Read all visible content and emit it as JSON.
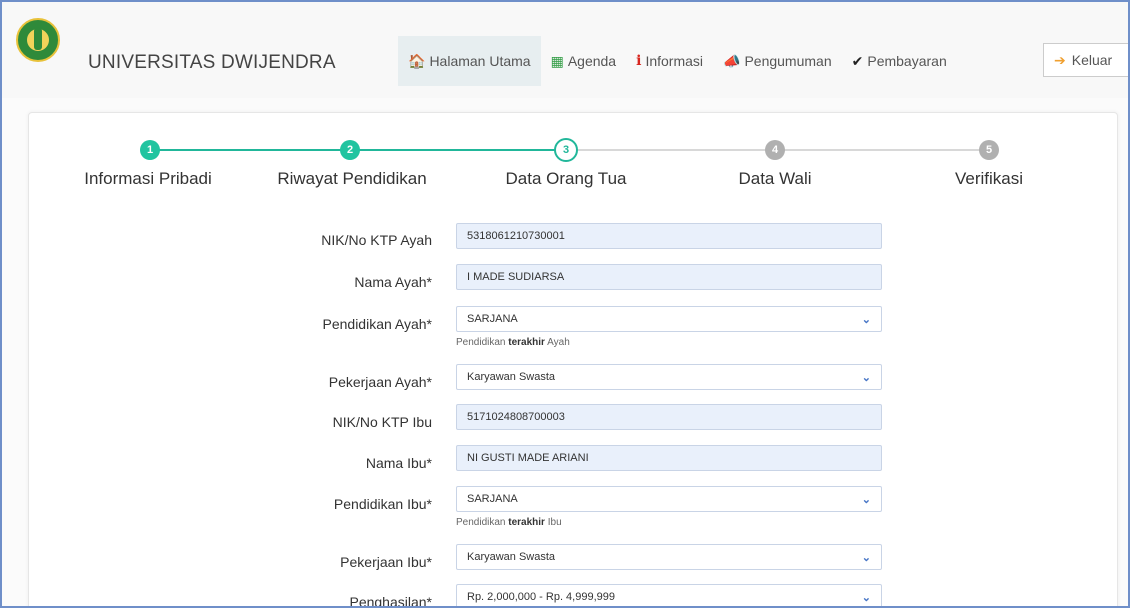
{
  "brand": {
    "name": "UNIVERSITAS DWIJENDRA"
  },
  "nav": {
    "items": [
      {
        "label": "Halaman Utama",
        "icon": "home-icon",
        "glyph": "🏠"
      },
      {
        "label": "Agenda",
        "icon": "calendar-icon",
        "glyph": "▦"
      },
      {
        "label": "Informasi",
        "icon": "info-icon",
        "glyph": "i"
      },
      {
        "label": "Pengumuman",
        "icon": "megaphone-icon",
        "glyph": "📣"
      },
      {
        "label": "Pembayaran",
        "icon": "check-icon",
        "glyph": "✔"
      }
    ],
    "logout_label": "Keluar"
  },
  "stepper": {
    "steps": [
      {
        "number": "1",
        "label": "Informasi Pribadi",
        "state": "done"
      },
      {
        "number": "2",
        "label": "Riwayat Pendidikan",
        "state": "done"
      },
      {
        "number": "3",
        "label": "Data Orang Tua",
        "state": "current"
      },
      {
        "number": "4",
        "label": "Data Wali",
        "state": "todo"
      },
      {
        "number": "5",
        "label": "Verifikasi",
        "state": "todo"
      }
    ],
    "accent": "#21b79a"
  },
  "form": {
    "nik_ayah": {
      "label": "NIK/No KTP Ayah",
      "value": "5318061210730001"
    },
    "nama_ayah": {
      "label": "Nama Ayah*",
      "value": "I MADE SUDIARSA"
    },
    "pendidikan_ayah": {
      "label": "Pendidikan Ayah*",
      "value": "SARJANA",
      "help_prefix": "Pendidikan ",
      "help_bold": "terakhir",
      "help_suffix": " Ayah"
    },
    "pekerjaan_ayah": {
      "label": "Pekerjaan Ayah*",
      "value": "Karyawan Swasta"
    },
    "nik_ibu": {
      "label": "NIK/No KTP Ibu",
      "value": "5171024808700003"
    },
    "nama_ibu": {
      "label": "Nama Ibu*",
      "value": "NI GUSTI MADE ARIANI"
    },
    "pendidikan_ibu": {
      "label": "Pendidikan Ibu*",
      "value": "SARJANA",
      "help_prefix": "Pendidikan ",
      "help_bold": "terakhir",
      "help_suffix": " Ibu"
    },
    "pekerjaan_ibu": {
      "label": "Pekerjaan Ibu*",
      "value": "Karyawan Swasta"
    },
    "penghasilan": {
      "label": "Penghasilan*",
      "value": "Rp. 2,000,000 - Rp. 4,999,999"
    }
  }
}
